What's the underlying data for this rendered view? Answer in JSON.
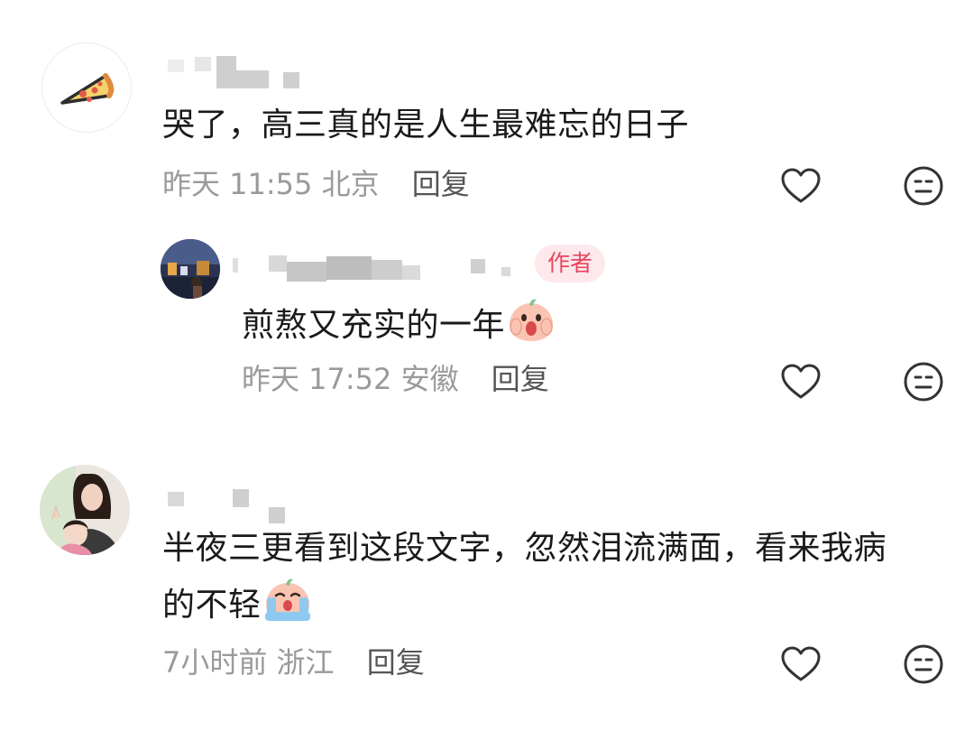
{
  "comments": [
    {
      "text": "哭了，高三真的是人生最难忘的日子",
      "time": "昨天 11:55",
      "location": "北京",
      "reply_label": "回复"
    },
    {
      "badge": "作者",
      "text": "煎熬又充实的一年",
      "time": "昨天 17:52",
      "location": "安徽",
      "reply_label": "回复"
    },
    {
      "text_line1": "半夜三更看到这段文字，忽然泪流满面，看来我病",
      "text_line2": "的不轻",
      "time": "7小时前",
      "location": "浙江",
      "reply_label": "回复"
    }
  ],
  "icons": {
    "like": "heart-outline-icon",
    "dislike": "neutral-face-icon",
    "emoji_shock": "shocked-peach-emoji",
    "emoji_cry": "crying-peach-emoji"
  },
  "colors": {
    "badge_text": "#e8455e",
    "badge_bg": "#fde8ec",
    "meta": "#9a9a9a"
  }
}
